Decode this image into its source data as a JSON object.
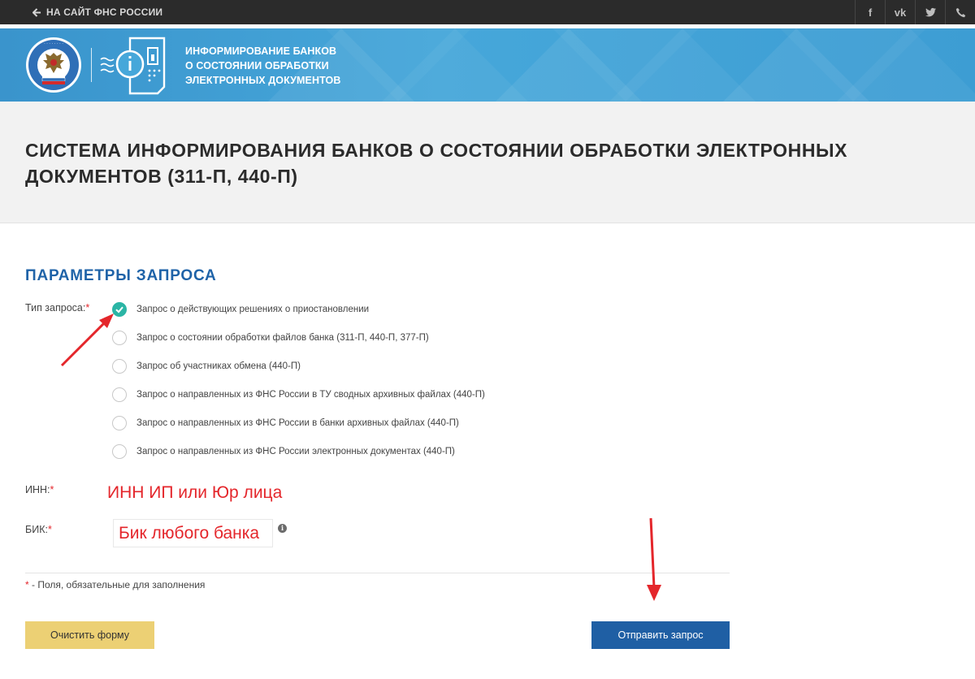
{
  "topbar": {
    "back_label": "НА САЙТ ФНС РОССИИ",
    "social": [
      {
        "name": "facebook-icon",
        "glyph": "f"
      },
      {
        "name": "vk-icon",
        "glyph": "vk"
      },
      {
        "name": "twitter-icon",
        "glyph": ""
      },
      {
        "name": "phone-icon",
        "glyph": ""
      }
    ]
  },
  "header": {
    "title_lines": [
      "ИНФОРМИРОВАНИЕ БАНКОВ",
      "О СОСТОЯНИИ ОБРАБОТКИ",
      "ЭЛЕКТРОННЫХ ДОКУМЕНТОВ"
    ],
    "emblem_text": "ФЕДЕРАЛЬНАЯ НАЛОГОВАЯ СЛУЖБА"
  },
  "page": {
    "title": "СИСТЕМА ИНФОРМИРОВАНИЯ БАНКОВ О СОСТОЯНИИ ОБРАБОТКИ ЭЛЕКТРОННЫХ ДОКУМЕНТОВ (311-П, 440-П)"
  },
  "form": {
    "section_title": "ПАРАМЕТРЫ ЗАПРОСА",
    "request_type_label": "Тип запроса:",
    "required_mark": "*",
    "options": [
      {
        "label": "Запрос о действующих решениях о приостановлении",
        "checked": true
      },
      {
        "label": "Запрос о состоянии обработки файлов банка (311-П, 440-П, 377-П)",
        "checked": false
      },
      {
        "label": "Запрос об участниках обмена (440-П)",
        "checked": false
      },
      {
        "label": "Запрос о направленных из ФНС России в ТУ сводных архивных файлах (440-П)",
        "checked": false
      },
      {
        "label": "Запрос о направленных из ФНС России в банки архивных файлах (440-П)",
        "checked": false
      },
      {
        "label": "Запрос о направленных из ФНС России электронных документах (440-П)",
        "checked": false
      }
    ],
    "inn_label": "ИНН:",
    "inn_value": "ИНН ИП или Юр лица",
    "bik_label": "БИК:",
    "bik_value": "Бик любого банка",
    "info_glyph": "i",
    "required_note": " - Поля, обязательные для заполнения",
    "clear_button": "Очистить форму",
    "submit_button": "Отправить запрос"
  },
  "colors": {
    "accent_blue": "#1f5fa4",
    "header_blue": "#46a7da",
    "check_teal": "#2bb5a5",
    "clear_yellow": "#ecd074",
    "annotation_red": "#e4262b"
  }
}
